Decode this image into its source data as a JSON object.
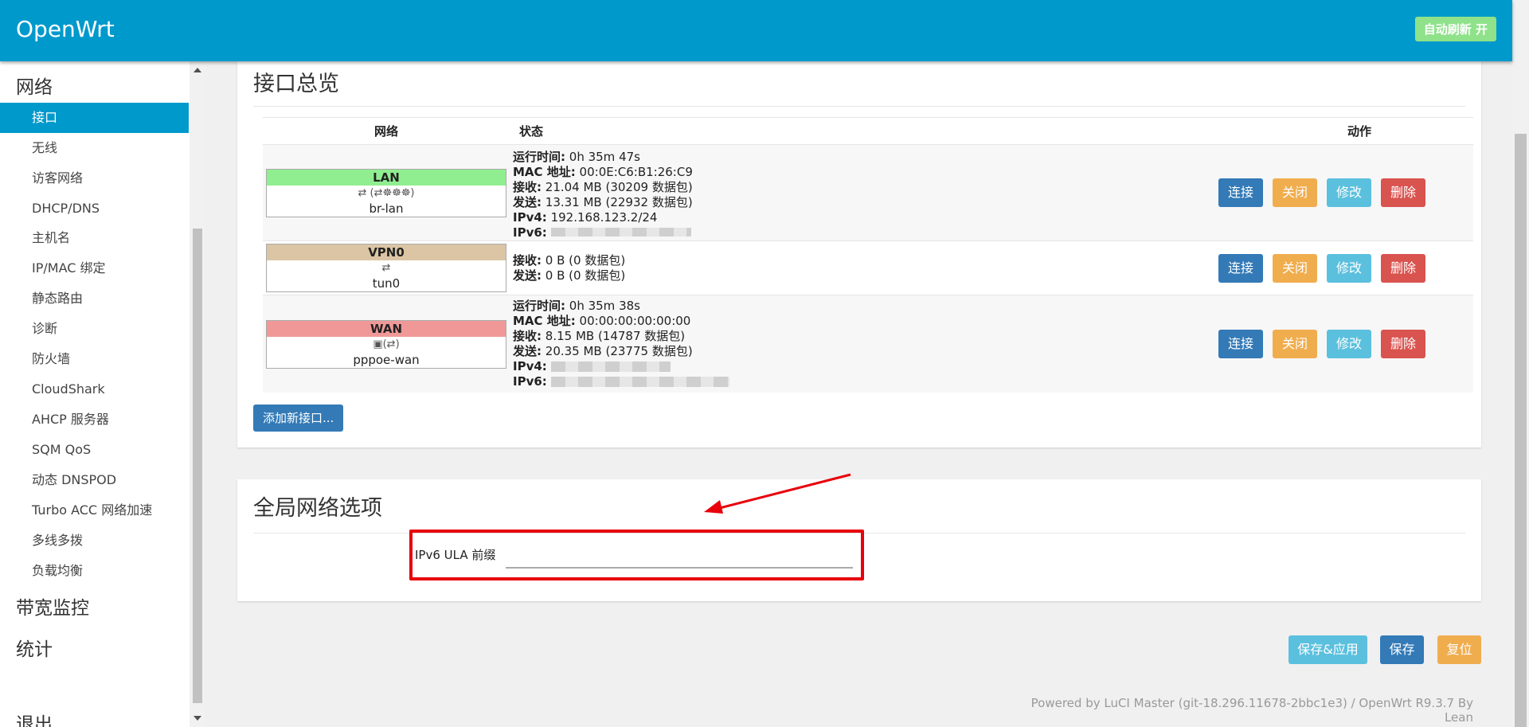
{
  "header": {
    "brand": "OpenWrt",
    "refresh_label": "自动刷新 开"
  },
  "sidebar": {
    "category_network": "网络",
    "items": [
      {
        "label": "接口",
        "active": true
      },
      {
        "label": "无线"
      },
      {
        "label": "访客网络"
      },
      {
        "label": "DHCP/DNS"
      },
      {
        "label": "主机名"
      },
      {
        "label": "IP/MAC 绑定"
      },
      {
        "label": "静态路由"
      },
      {
        "label": "诊断"
      },
      {
        "label": "防火墙"
      },
      {
        "label": "CloudShark"
      },
      {
        "label": "AHCP 服务器"
      },
      {
        "label": "SQM QoS"
      },
      {
        "label": "动态 DNSPOD"
      },
      {
        "label": "Turbo ACC 网络加速"
      },
      {
        "label": "多线多拨"
      },
      {
        "label": "负载均衡"
      }
    ],
    "category_bandwidth": "带宽监控",
    "category_stats": "统计",
    "category_logout": "退出"
  },
  "overview": {
    "title": "接口总览",
    "columns": {
      "network": "网络",
      "status": "状态",
      "actions": "动作"
    },
    "labels": {
      "uptime": "运行时间:",
      "mac": "MAC 地址:",
      "rx": "接收:",
      "tx": "发送:",
      "ipv4": "IPv4:",
      "ipv6": "IPv6:"
    },
    "interfaces": [
      {
        "name": "LAN",
        "color": "#90ee90",
        "device": "br-lan",
        "icons": "⇄ (⇄☸☸☸)",
        "uptime": "0h 35m 47s",
        "mac": "00:0E:C6:B1:26:C9",
        "rx": "21.04 MB (30209 数据包)",
        "tx": "13.31 MB (22932 数据包)",
        "ipv4": "192.168.123.2/24"
      },
      {
        "name": "VPN0",
        "color": "#dbc5a4",
        "device": "tun0",
        "icons": "⇄",
        "rx": "0 B (0 数据包)",
        "tx": "0 B (0 数据包)"
      },
      {
        "name": "WAN",
        "color": "#f09898",
        "device": "pppoe-wan",
        "icons": "▣(⇄)",
        "uptime": "0h 35m 38s",
        "mac": "00:00:00:00:00:00",
        "rx": "8.15 MB (14787 数据包)",
        "tx": "20.35 MB (23775 数据包)"
      }
    ],
    "buttons": {
      "connect": "连接",
      "stop": "关闭",
      "edit": "修改",
      "delete": "删除"
    },
    "add_button": "添加新接口..."
  },
  "global": {
    "title": "全局网络选项",
    "ula_label": "IPv6 ULA 前缀",
    "ula_value": ""
  },
  "bottom": {
    "save_apply": "保存&应用",
    "save": "保存",
    "reset": "复位"
  },
  "footer": "Powered by LuCI Master (git-18.296.11678-2bbc1e3) / OpenWrt R9.3.7 By Lean"
}
